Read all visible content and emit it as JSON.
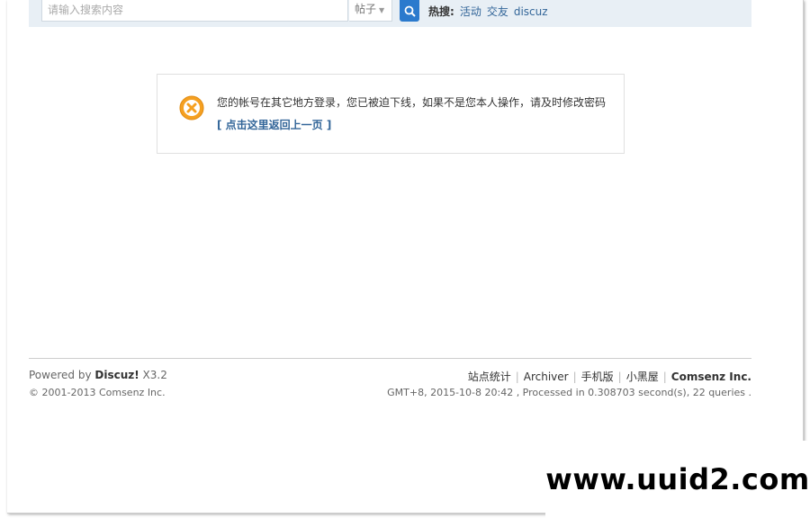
{
  "search": {
    "placeholder": "请输入搜索内容",
    "type_label": "帖子",
    "hot_label": "热搜:",
    "hot_words": [
      "活动",
      "交友",
      "discuz"
    ]
  },
  "alert": {
    "message": "您的帐号在其它地方登录，您已被迫下线，如果不是您本人操作，请及时修改密码",
    "back_link": "[ 点击这里返回上一页 ]"
  },
  "footer": {
    "powered_prefix": "Powered by ",
    "powered_brand": "Discuz!",
    "powered_version": " X3.2",
    "copyright": "© 2001-2013 Comsenz Inc.",
    "links": [
      "站点统计",
      "Archiver",
      "手机版",
      "小黑屋",
      "Comsenz Inc."
    ],
    "server_info": "GMT+8, 2015-10-8 20:42 , Processed in 0.308703 second(s), 22 queries ."
  },
  "watermark": "www.uuid2.com",
  "colors": {
    "accent": "#2b7acd",
    "link": "#336699",
    "alert_icon": "#f5a021"
  }
}
